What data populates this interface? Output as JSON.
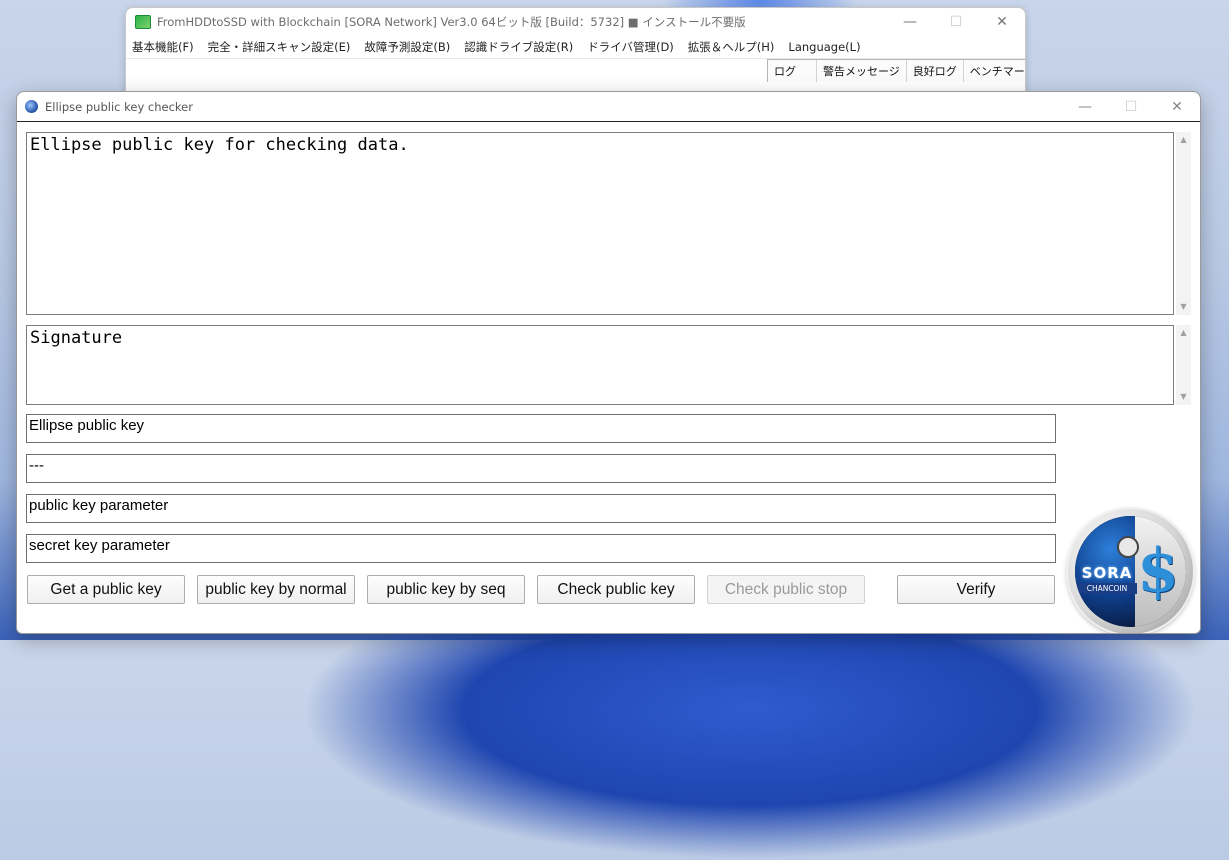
{
  "background_window": {
    "title": "FromHDDtoSSD with Blockchain [SORA Network] Ver3.0 64ビット版 [Build：5732] ■ インストール不要版",
    "menu": [
      "基本機能(F)",
      "完全・詳細スキャン設定(E)",
      "故障予測設定(B)",
      "認識ドライブ設定(R)",
      "ドライバ管理(D)",
      "拡張＆ヘルプ(H)",
      "Language(L)"
    ],
    "tabs": [
      "ログ",
      "警告メッセージ",
      "良好ログ",
      "ベンチマーク"
    ]
  },
  "window_controls": {
    "minimize": "—",
    "maximize": "☐",
    "close": "✕"
  },
  "dialog": {
    "title": "Ellipse public key checker",
    "data_memo": "Ellipse public key for checking data.",
    "signature_memo": "Signature",
    "fields": {
      "public_key": "Ellipse public key",
      "separator": "---",
      "public_key_parameter": "public key parameter",
      "secret_key_parameter": "secret key parameter"
    },
    "buttons": {
      "get_public_key": "Get a public key",
      "public_key_by_normal": "public key by normal",
      "public_key_by_seq": "public key by seq",
      "check_public_key": "Check public key",
      "check_public_stop": "Check public stop",
      "verify": "Verify"
    }
  },
  "logo": {
    "text_main": "SORA",
    "text_sub": "CHANCOIN",
    "symbol": "$"
  },
  "colors": {
    "accent_blue": "#2e8fd9",
    "disabled_text": "#9a9a9a",
    "app_icon_green": "#2ab34a"
  },
  "icons": {
    "app_icon": "fromhddtossd-app-icon",
    "dialog_icon": "sora-dialog-icon",
    "scroll_up": "scroll-up-arrow-icon",
    "scroll_down": "scroll-down-arrow-icon"
  }
}
